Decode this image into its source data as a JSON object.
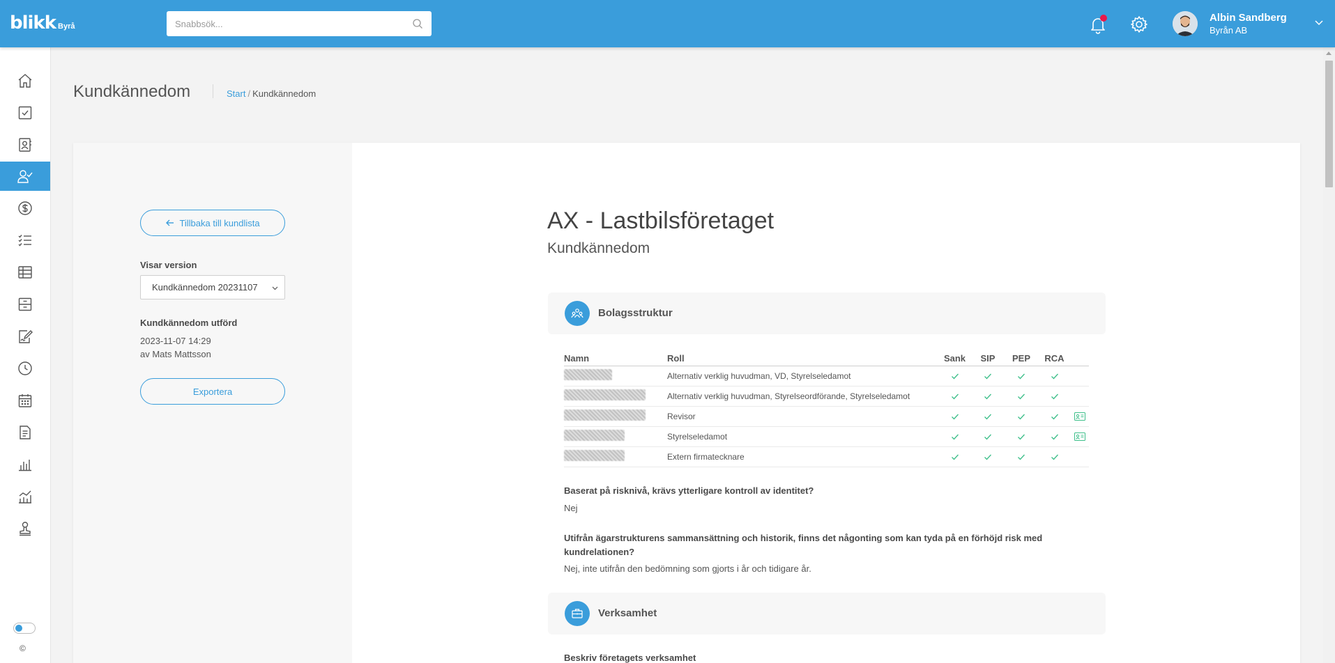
{
  "topbar": {
    "logo_main": "blikk",
    "logo_sub": "Byrå",
    "search_placeholder": "Snabbsök...",
    "user_name": "Albin Sandberg",
    "user_company": "Byrån AB",
    "accent": "#3a9ddb",
    "notification_color": "#e8194b"
  },
  "sidebar": {
    "items": [
      "home-icon",
      "checklist-icon",
      "contacts-icon",
      "user-check-icon",
      "dollar-icon",
      "task-list-icon",
      "table-icon",
      "archive-icon",
      "sign-document-icon",
      "clock-icon",
      "calendar-icon",
      "document-icon",
      "bar-chart-icon",
      "line-chart-icon",
      "stamp-icon"
    ],
    "active_index": 3,
    "copyright": "©"
  },
  "header": {
    "title": "Kundkännedom",
    "breadcrumb_start": "Start",
    "breadcrumb_sep": "/",
    "breadcrumb_current": "Kundkännedom"
  },
  "left": {
    "back_label": "Tillbaka till kundlista",
    "version_label": "Visar version",
    "version_value": "Kundkännedom 20231107",
    "performed_label": "Kundkännedom utförd",
    "performed_date": "2023-11-07 14:29",
    "performed_by": "av Mats Mattsson",
    "export_label": "Exportera"
  },
  "main": {
    "company": "AX - Lastbilsföretaget",
    "subtitle": "Kundkännedom",
    "section1": "Bolagsstruktur",
    "section2": "Verksamhet",
    "table": {
      "headers": [
        "Namn",
        "Roll",
        "Sank",
        "SIP",
        "PEP",
        "RCA"
      ],
      "rows": [
        {
          "name_width": 0.53,
          "role": "Alternativ verklig huvudman, VD, Styrelseledamot",
          "id_card": false
        },
        {
          "name_width": 0.9,
          "role": "Alternativ verklig huvudman, Styrelseordförande, Styrelseledamot",
          "id_card": false
        },
        {
          "name_width": 0.9,
          "role": "Revisor",
          "id_card": true
        },
        {
          "name_width": 0.67,
          "role": "Styrelseledamot",
          "id_card": true
        },
        {
          "name_width": 0.67,
          "role": "Extern firmatecknare",
          "id_card": false
        }
      ]
    },
    "q1": "Baserat på risknivå, krävs ytterligare kontroll av identitet?",
    "a1": "Nej",
    "q2": "Utifrån ägarstrukturens sammansättning och historik, finns det någonting som kan tyda på en förhöjd risk med kundrelationen?",
    "a2": "Nej, inte utifrån den bedömning som gjorts i år och tidigare år.",
    "q3": "Beskriv företagets verksamhet"
  }
}
